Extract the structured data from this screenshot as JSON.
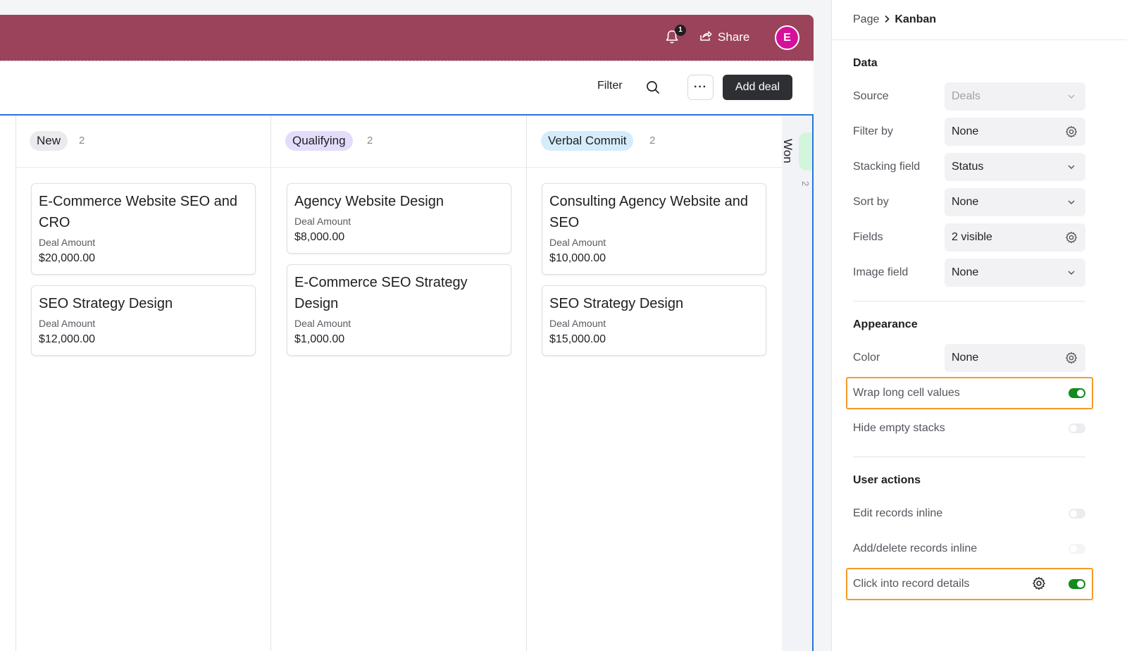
{
  "header": {
    "notification_count": "1",
    "share_label": "Share",
    "avatar_initial": "E",
    "brand_color": "#9b435a"
  },
  "toolbar": {
    "filter_label": "Filter",
    "more_label": "···",
    "add_label": "Add deal"
  },
  "board": {
    "columns": [
      {
        "name": "New",
        "count": "2",
        "pill_color": "#ebebef",
        "cards": [
          {
            "title": "E-Commerce Website SEO and CRO",
            "label": "Deal Amount",
            "value": "$20,000.00"
          },
          {
            "title": "SEO Strategy Design",
            "label": "Deal Amount",
            "value": "$12,000.00"
          }
        ]
      },
      {
        "name": "Qualifying",
        "count": "2",
        "pill_color": "#e4dcfb",
        "cards": [
          {
            "title": "Agency Website Design",
            "label": "Deal Amount",
            "value": "$8,000.00"
          },
          {
            "title": "E-Commerce SEO Strategy Design",
            "label": "Deal Amount",
            "value": "$1,000.00"
          }
        ]
      },
      {
        "name": "Verbal Commit",
        "count": "2",
        "pill_color": "#d5ecfb",
        "cards": [
          {
            "title": "Consulting Agency Website and SEO",
            "label": "Deal Amount",
            "value": "$10,000.00"
          },
          {
            "title": "SEO Strategy Design",
            "label": "Deal Amount",
            "value": "$15,000.00"
          }
        ]
      }
    ],
    "partial_column": {
      "name": "Won",
      "count": "2",
      "pill_color": "#d3f5dc"
    }
  },
  "panel": {
    "breadcrumb": {
      "page": "Page",
      "current": "Kanban"
    },
    "data_section": {
      "title": "Data",
      "source": {
        "label": "Source",
        "value": "Deals"
      },
      "filter_by": {
        "label": "Filter by",
        "value": "None"
      },
      "stacking_field": {
        "label": "Stacking field",
        "value": "Status"
      },
      "sort_by": {
        "label": "Sort by",
        "value": "None"
      },
      "fields": {
        "label": "Fields",
        "value": "2 visible"
      },
      "image_field": {
        "label": "Image field",
        "value": "None"
      }
    },
    "appearance_section": {
      "title": "Appearance",
      "color": {
        "label": "Color",
        "value": "None"
      },
      "wrap_long_cell_values": {
        "label": "Wrap long cell values",
        "enabled": true
      },
      "hide_empty_stacks": {
        "label": "Hide empty stacks",
        "enabled": false
      }
    },
    "user_actions_section": {
      "title": "User actions",
      "edit_records_inline": {
        "label": "Edit records inline",
        "enabled": false
      },
      "add_delete_records_inline": {
        "label": "Add/delete records inline",
        "enabled": false
      },
      "click_into_record_details": {
        "label": "Click into record details",
        "enabled": true
      }
    },
    "highlight_color": "#f59a2b",
    "toggle_on_color": "#138a1e"
  }
}
